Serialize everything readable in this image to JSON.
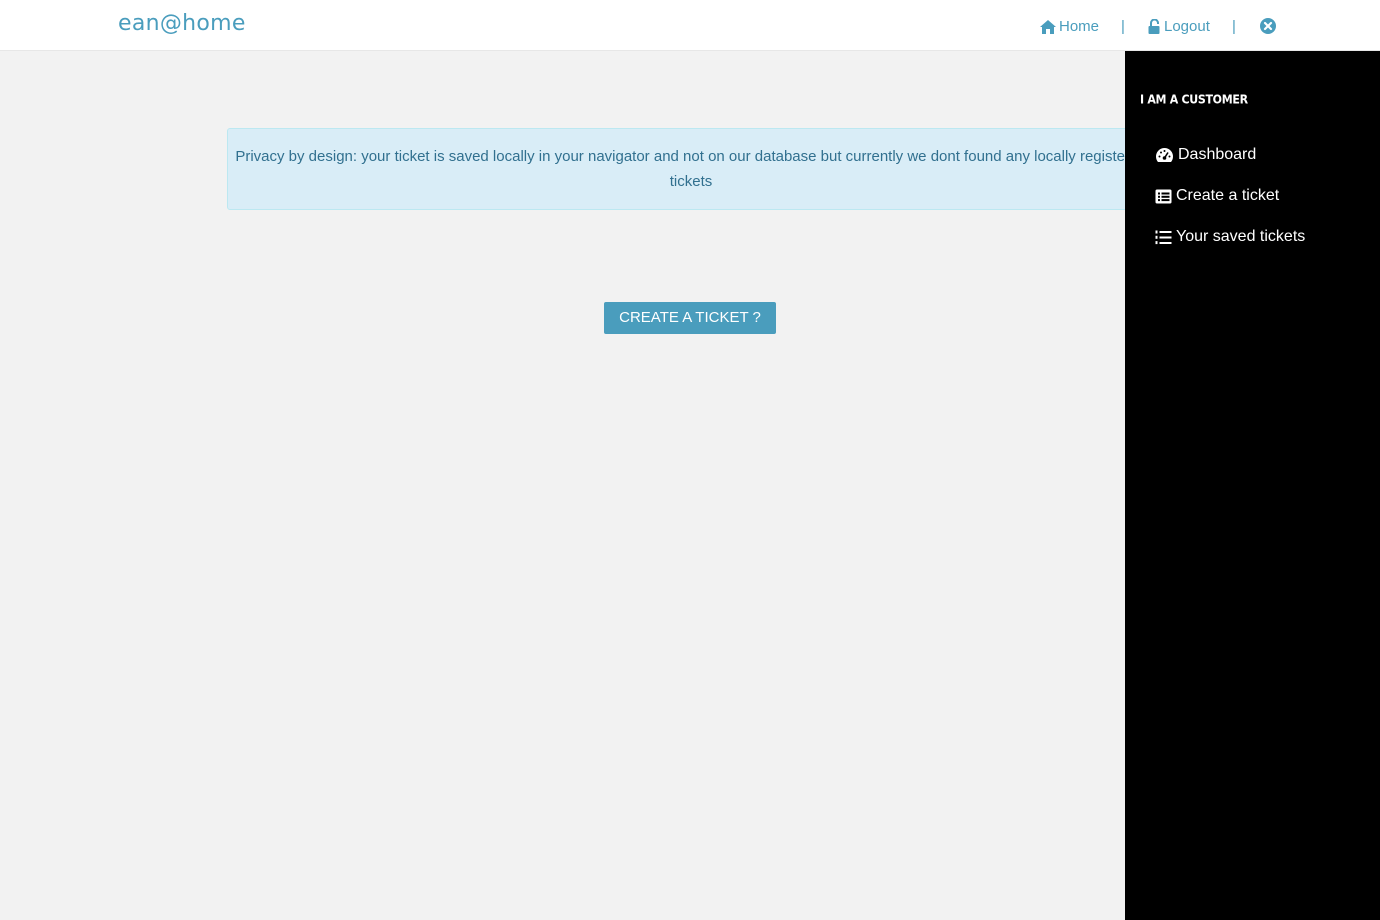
{
  "navbar": {
    "brand": "ean@home",
    "home_label": "Home",
    "logout_label": "Logout",
    "separator": "|",
    "icons": {
      "home": "home-icon",
      "logout": "unlock-icon",
      "close": "close-circle-icon"
    },
    "link_color": "#4a9dbd"
  },
  "main": {
    "alert_text": "Privacy by design: your ticket is saved locally in your navigator and not on our database but currently we dont found any locally registered tickets",
    "cta_label": "CREATE A TICKET ?",
    "alert_bg": "#d9edf7",
    "cta_color": "#4a9dbd"
  },
  "sidebar": {
    "title": "I AM A CUSTOMER",
    "items": [
      {
        "label": "Dashboard",
        "icon": "dashboard-icon"
      },
      {
        "label": "Create a ticket",
        "icon": "list-alt-icon"
      },
      {
        "label": "Your saved tickets",
        "icon": "list-ol-icon"
      }
    ],
    "bg": "#000000"
  }
}
